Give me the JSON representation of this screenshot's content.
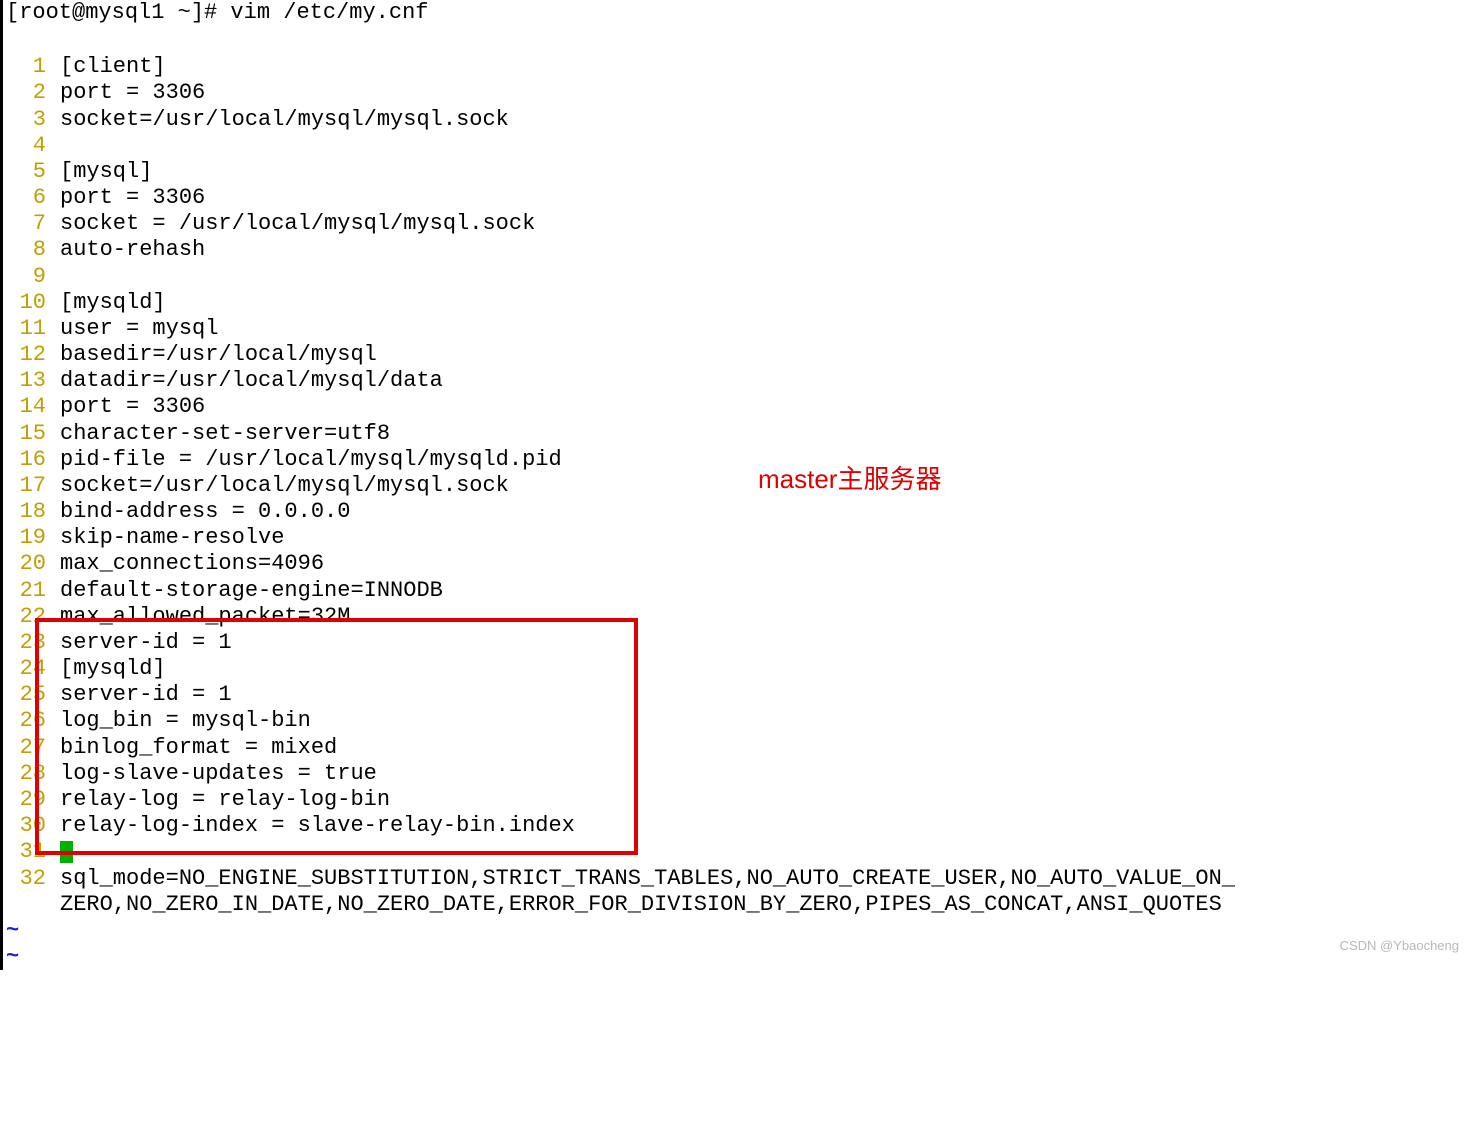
{
  "prompt": "[root@mysql1 ~]# vim /etc/my.cnf",
  "lines": [
    {
      "n": "1",
      "t": "[client]"
    },
    {
      "n": "2",
      "t": "port = 3306"
    },
    {
      "n": "3",
      "t": "socket=/usr/local/mysql/mysql.sock"
    },
    {
      "n": "4",
      "t": ""
    },
    {
      "n": "5",
      "t": "[mysql]"
    },
    {
      "n": "6",
      "t": "port = 3306"
    },
    {
      "n": "7",
      "t": "socket = /usr/local/mysql/mysql.sock"
    },
    {
      "n": "8",
      "t": "auto-rehash"
    },
    {
      "n": "9",
      "t": ""
    },
    {
      "n": "10",
      "t": "[mysqld]"
    },
    {
      "n": "11",
      "t": "user = mysql"
    },
    {
      "n": "12",
      "t": "basedir=/usr/local/mysql"
    },
    {
      "n": "13",
      "t": "datadir=/usr/local/mysql/data"
    },
    {
      "n": "14",
      "t": "port = 3306"
    },
    {
      "n": "15",
      "t": "character-set-server=utf8"
    },
    {
      "n": "16",
      "t": "pid-file = /usr/local/mysql/mysqld.pid"
    },
    {
      "n": "17",
      "t": "socket=/usr/local/mysql/mysql.sock"
    },
    {
      "n": "18",
      "t": "bind-address = 0.0.0.0"
    },
    {
      "n": "19",
      "t": "skip-name-resolve"
    },
    {
      "n": "20",
      "t": "max_connections=4096"
    },
    {
      "n": "21",
      "t": "default-storage-engine=INNODB"
    },
    {
      "n": "22",
      "t": "max_allowed_packet=32M"
    },
    {
      "n": "23",
      "t": "server-id = 1"
    },
    {
      "n": "24",
      "t": "[mysqld]"
    },
    {
      "n": "25",
      "t": "server-id = 1"
    },
    {
      "n": "26",
      "t": "log_bin = mysql-bin"
    },
    {
      "n": "27",
      "t": "binlog_format = mixed"
    },
    {
      "n": "28",
      "t": "log-slave-updates = true"
    },
    {
      "n": "29",
      "t": "relay-log = relay-log-bin"
    },
    {
      "n": "30",
      "t": "relay-log-index = slave-relay-bin.index"
    },
    {
      "n": "31",
      "t": ""
    },
    {
      "n": "32",
      "t": "sql_mode=NO_ENGINE_SUBSTITUTION,STRICT_TRANS_TABLES,NO_AUTO_CREATE_USER,NO_AUTO_VALUE_ON_"
    }
  ],
  "wrapped_line": "ZERO,NO_ZERO_IN_DATE,NO_ZERO_DATE,ERROR_FOR_DIVISION_BY_ZERO,PIPES_AS_CONCAT,ANSI_QUOTES",
  "tilde": "~",
  "annotation": "master主服务器",
  "watermark": "CSDN @Ybaocheng"
}
